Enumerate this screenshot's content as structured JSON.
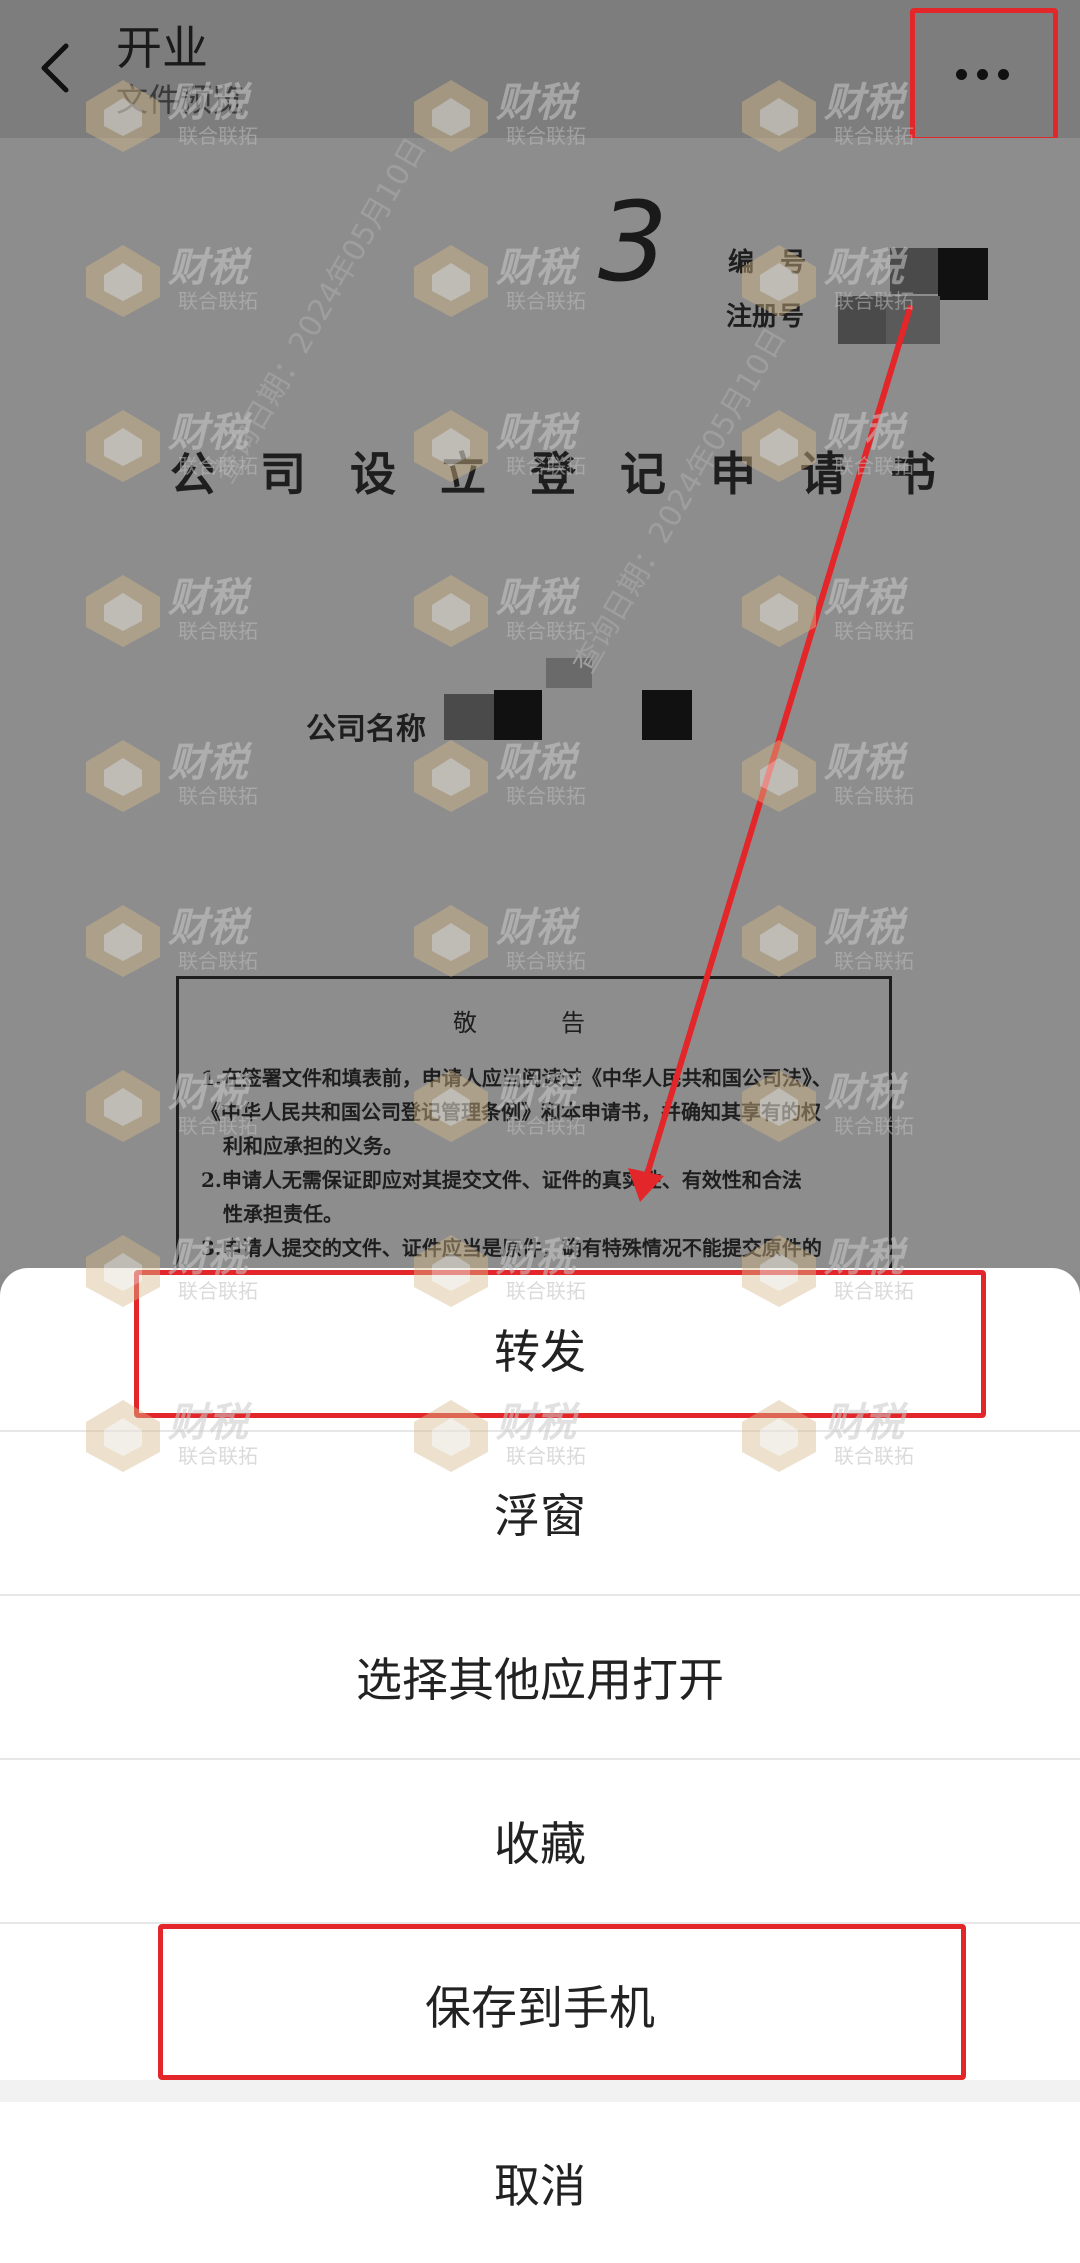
{
  "header": {
    "title": "开业",
    "subtitle": "文件预览"
  },
  "document": {
    "handwritten_mark": "3",
    "field_number_label": "编　号",
    "field_registration_label": "注册号",
    "title": "公司设立登记申请书",
    "company_name_label": "公司名称",
    "notice_title": "敬　告",
    "notice_lines": [
      "1.在签署文件和填表前，申请人应当阅读过《中华人民共和国公司法》、",
      "《中华人民共和国公司登记管理条例》和本申请书，并确知其享有的权",
      "利和应承担的义务。",
      "2.申请人无需保证即应对其提交文件、证件的真实性、有效性和合法",
      "性承担责任。",
      "3.申请人提交的文件、证件应当是原件，确有特殊情况不能提交原件的"
    ],
    "watermark_text": "查询日期：2024年05月10日"
  },
  "sheet": {
    "items": [
      {
        "label": "转发"
      },
      {
        "label": "浮窗"
      },
      {
        "label": "选择其他应用打开"
      },
      {
        "label": "收藏"
      },
      {
        "label": "保存到手机"
      }
    ],
    "cancel_label": "取消"
  },
  "watermark": {
    "main": "财税",
    "sub": "联合联拓"
  },
  "colors": {
    "highlight": "#e3262a",
    "overlay": "#8a8a8a",
    "sheet_bg": "#ffffff"
  }
}
